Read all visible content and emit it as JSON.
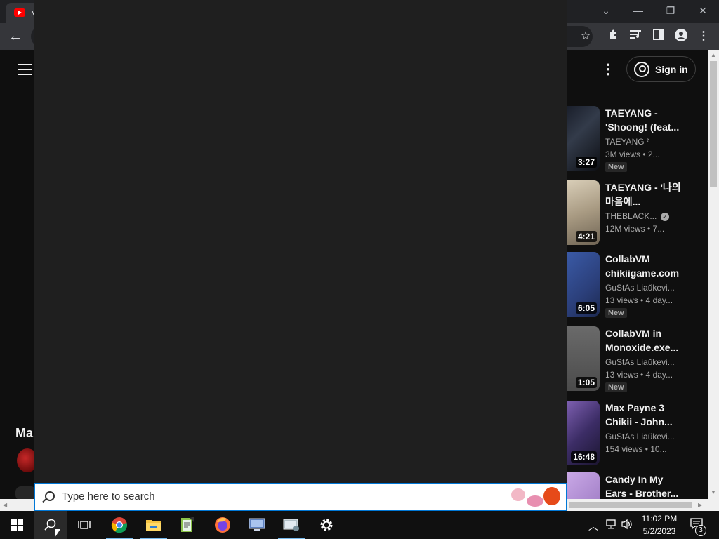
{
  "browser": {
    "tab_title": "M",
    "window_controls": {
      "minimize": "—",
      "restore": "❐",
      "close": "✕",
      "tab_dropdown": "⌄"
    }
  },
  "youtube": {
    "sign_in_label": "Sign in",
    "partial_section_title": "Ma",
    "recommendations": [
      {
        "title": "TAEYANG - 'Shoong! (feat...",
        "channel": "TAEYANG",
        "meta": "3M views • 2...",
        "duration": "3:27",
        "badge": "New",
        "verified": false,
        "music": true
      },
      {
        "title": "TAEYANG - '나의 마음에...",
        "channel": "THEBLACK...",
        "meta": "12M views • 7...",
        "duration": "4:21",
        "badge": "",
        "verified": true,
        "music": false
      },
      {
        "title": "CollabVM chikiigame.com",
        "channel": "GuStAs Liaŭkevi...",
        "meta": "13 views • 4 day...",
        "duration": "6:05",
        "badge": "New",
        "verified": false,
        "music": false
      },
      {
        "title": "CollabVM in Monoxide.exe...",
        "channel": "GuStAs Liaŭkevi...",
        "meta": "13 views • 4 day...",
        "duration": "1:05",
        "badge": "New",
        "verified": false,
        "music": false
      },
      {
        "title": "Max Payne 3 Chikii - John...",
        "channel": "GuStAs Liaŭkevi...",
        "meta": "154 views • 10...",
        "duration": "16:48",
        "badge": "",
        "verified": false,
        "music": false
      },
      {
        "title": "Candy In My Ears - Brother...",
        "channel": "",
        "meta": "",
        "duration": "",
        "badge": "",
        "verified": false,
        "music": false
      }
    ]
  },
  "search": {
    "placeholder": "Type here to search"
  },
  "taskbar": {
    "apps": [
      "start-icon",
      "search-icon",
      "task-view-icon",
      "chrome-icon",
      "file-explorer-icon",
      "notepad-icon",
      "firefox-icon",
      "network-app-icon",
      "control-panel-icon",
      "settings-icon"
    ],
    "time": "11:02 PM",
    "date": "5/2/2023",
    "notification_count": "3"
  }
}
